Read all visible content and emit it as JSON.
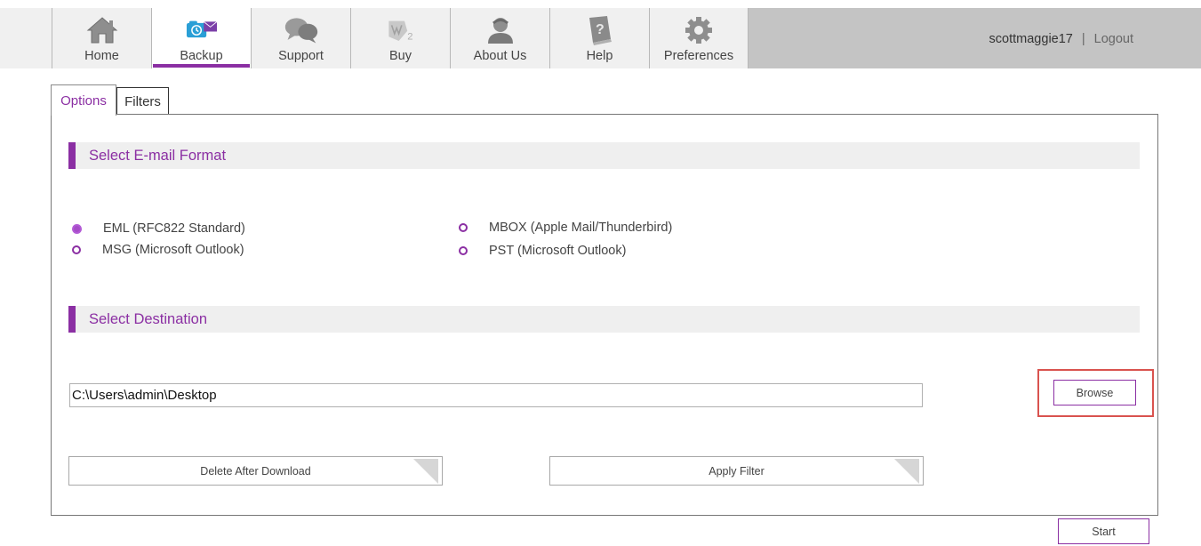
{
  "nav": {
    "items": [
      {
        "label": "Home",
        "icon": "home-icon",
        "active": false
      },
      {
        "label": "Backup",
        "icon": "backup-icon",
        "active": true
      },
      {
        "label": "Support",
        "icon": "chat-bubbles-icon",
        "active": false
      },
      {
        "label": "Buy",
        "icon": "buy-icon",
        "active": false
      },
      {
        "label": "About Us",
        "icon": "person-icon",
        "active": false
      },
      {
        "label": "Help",
        "icon": "help-book-icon",
        "active": false
      },
      {
        "label": "Preferences",
        "icon": "gear-icon",
        "active": false
      }
    ],
    "username": "scottmaggie17",
    "separator": "|",
    "logout": "Logout"
  },
  "tabs": {
    "options": "Options",
    "filters": "Filters"
  },
  "email_format": {
    "title": "Select E-mail Format",
    "options": [
      {
        "label": "EML (RFC822 Standard)",
        "checked": true
      },
      {
        "label": "MSG (Microsoft Outlook)",
        "checked": false
      },
      {
        "label": "MBOX (Apple Mail/Thunderbird)",
        "checked": false
      },
      {
        "label": "PST (Microsoft Outlook)",
        "checked": false
      }
    ]
  },
  "destination": {
    "title": "Select Destination",
    "path": "C:\\Users\\admin\\Desktop",
    "browse_label": "Browse"
  },
  "actions": {
    "delete_after_download": "Delete After Download",
    "apply_filter": "Apply Filter",
    "start": "Start"
  },
  "colors": {
    "accent": "#8b2fa3",
    "highlight": "#d9534f"
  }
}
